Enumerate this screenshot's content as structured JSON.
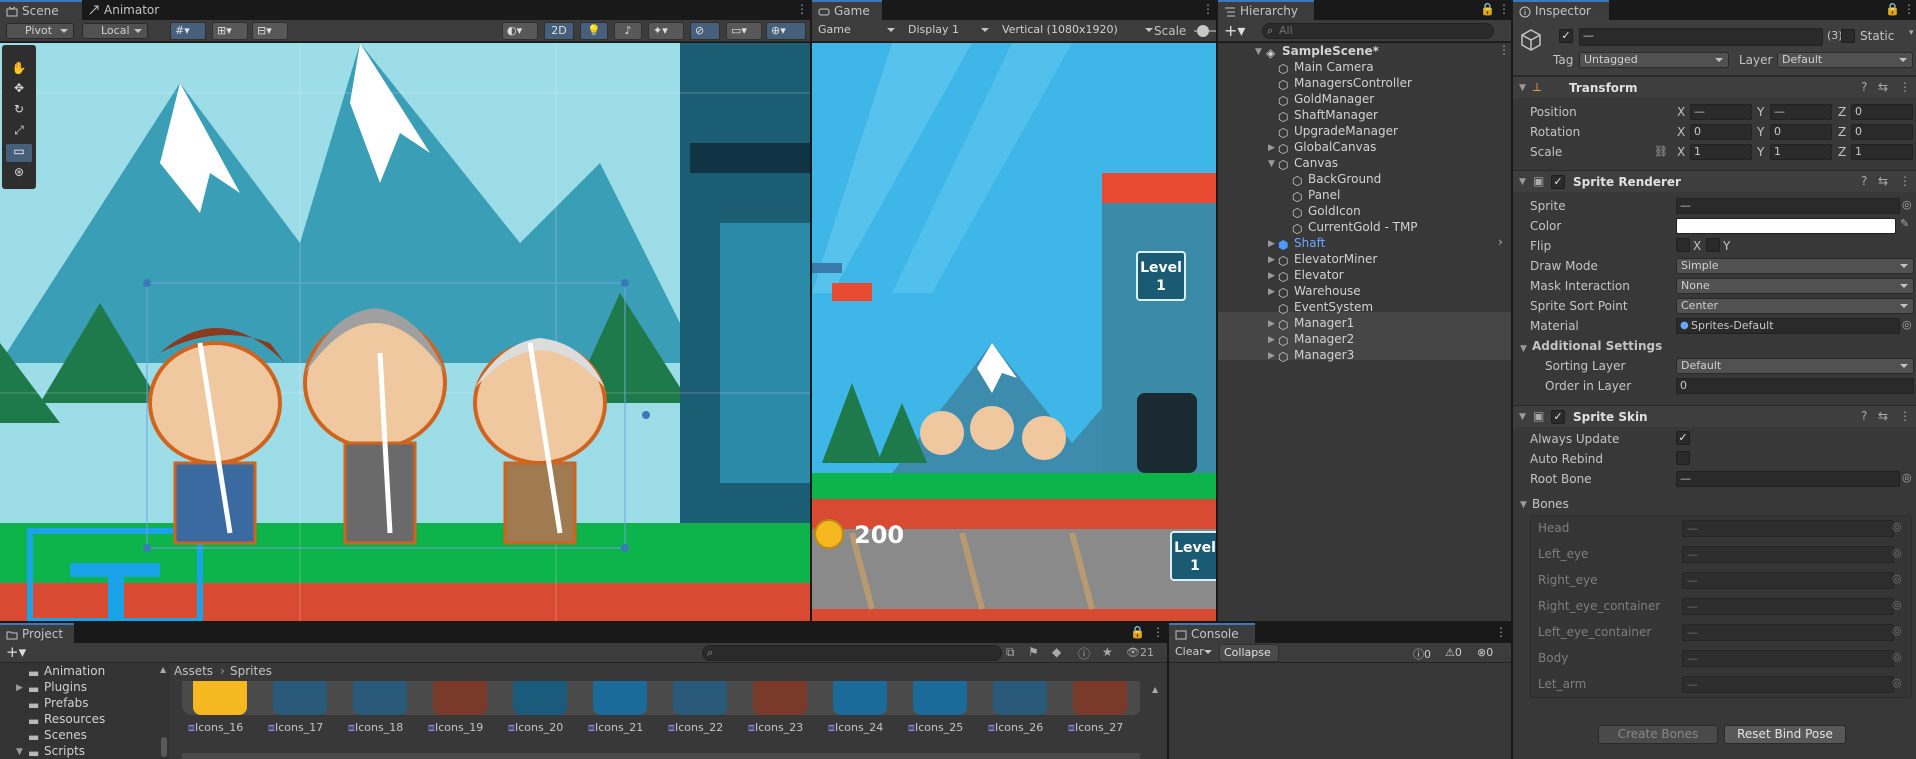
{
  "scene_panel": {
    "tabs": [
      {
        "label": "Scene"
      },
      {
        "label": "Animator"
      }
    ],
    "toolbar": {
      "pivot": "Pivot",
      "local": "Local",
      "mode_2d": "2D"
    }
  },
  "game_panel": {
    "tab": "Game",
    "toolbar": {
      "view": "Game",
      "display": "Display 1",
      "aspect": "Vertical (1080x1920)",
      "scale_label": "Scale"
    },
    "hud": {
      "gold": "200",
      "level_label": "Level",
      "level_value": "1"
    }
  },
  "hierarchy": {
    "tab": "Hierarchy",
    "search_placeholder": "All",
    "scene_name": "SampleScene*",
    "items": [
      {
        "label": "Main Camera"
      },
      {
        "label": "ManagersController"
      },
      {
        "label": "GoldManager"
      },
      {
        "label": "ShaftManager"
      },
      {
        "label": "UpgradeManager"
      },
      {
        "label": "GlobalCanvas"
      },
      {
        "label": "Canvas"
      },
      {
        "label": "BackGround"
      },
      {
        "label": "Panel"
      },
      {
        "label": "GoldIcon"
      },
      {
        "label": "CurrentGold - TMP"
      },
      {
        "label": "Shaft"
      },
      {
        "label": "ElevatorMiner"
      },
      {
        "label": "Elevator"
      },
      {
        "label": "Warehouse"
      },
      {
        "label": "EventSystem"
      },
      {
        "label": "Manager1"
      },
      {
        "label": "Manager2"
      },
      {
        "label": "Manager3"
      }
    ]
  },
  "inspector": {
    "tab": "Inspector",
    "object": {
      "name": "—",
      "count": "(3)",
      "static_label": "Static",
      "tag_label": "Tag",
      "tag_value": "Untagged",
      "layer_label": "Layer",
      "layer_value": "Default"
    },
    "transform": {
      "title": "Transform",
      "position": {
        "label": "Position",
        "x": "—",
        "y": "—",
        "z": "0"
      },
      "rotation": {
        "label": "Rotation",
        "x": "0",
        "y": "0",
        "z": "0"
      },
      "scale": {
        "label": "Scale",
        "x": "1",
        "y": "1",
        "z": "1"
      },
      "axis": {
        "x": "X",
        "y": "Y",
        "z": "Z"
      }
    },
    "sprite_renderer": {
      "title": "Sprite Renderer",
      "sprite_label": "Sprite",
      "sprite_value": "—",
      "color_label": "Color",
      "color_value": "#ffffff",
      "flip_label": "Flip",
      "flip_x": "X",
      "flip_y": "Y",
      "draw_mode_label": "Draw Mode",
      "draw_mode_value": "Simple",
      "mask_label": "Mask Interaction",
      "mask_value": "None",
      "sort_point_label": "Sprite Sort Point",
      "sort_point_value": "Center",
      "material_label": "Material",
      "material_value": "Sprites-Default",
      "additional_settings": "Additional Settings",
      "sorting_layer_label": "Sorting Layer",
      "sorting_layer_value": "Default",
      "order_label": "Order in Layer",
      "order_value": "0"
    },
    "sprite_skin": {
      "title": "Sprite Skin",
      "always_update_label": "Always Update",
      "always_update": true,
      "auto_rebind_label": "Auto Rebind",
      "auto_rebind": false,
      "root_bone_label": "Root Bone",
      "root_bone_value": "—",
      "bones_label": "Bones",
      "bones": [
        {
          "label": "Head",
          "value": "—"
        },
        {
          "label": "Left_eye",
          "value": "—"
        },
        {
          "label": "Right_eye",
          "value": "—"
        },
        {
          "label": "Right_eye_container",
          "value": "—"
        },
        {
          "label": "Left_eye_container",
          "value": "—"
        },
        {
          "label": "Body",
          "value": "—"
        },
        {
          "label": "Let_arm",
          "value": "—"
        }
      ],
      "create_bones": "Create Bones",
      "reset_bind_pose": "Reset Bind Pose"
    }
  },
  "project": {
    "tab": "Project",
    "folders": [
      {
        "label": "Animation"
      },
      {
        "label": "Plugins"
      },
      {
        "label": "Prefabs"
      },
      {
        "label": "Resources"
      },
      {
        "label": "Scenes"
      },
      {
        "label": "Scripts"
      }
    ],
    "breadcrumb": {
      "root": "Assets",
      "current": "Sprites"
    },
    "hidden_count": "21",
    "assets": [
      {
        "label": "Icons_16"
      },
      {
        "label": "Icons_17"
      },
      {
        "label": "Icons_18"
      },
      {
        "label": "Icons_19"
      },
      {
        "label": "Icons_20"
      },
      {
        "label": "Icons_21"
      },
      {
        "label": "Icons_22"
      },
      {
        "label": "Icons_23"
      },
      {
        "label": "Icons_24"
      },
      {
        "label": "Icons_25"
      },
      {
        "label": "Icons_26"
      },
      {
        "label": "Icons_27"
      }
    ]
  },
  "console": {
    "tab": "Console",
    "clear": "Clear",
    "collapse": "Collapse",
    "counts": {
      "log": "0",
      "warn": "0",
      "error": "0"
    }
  }
}
